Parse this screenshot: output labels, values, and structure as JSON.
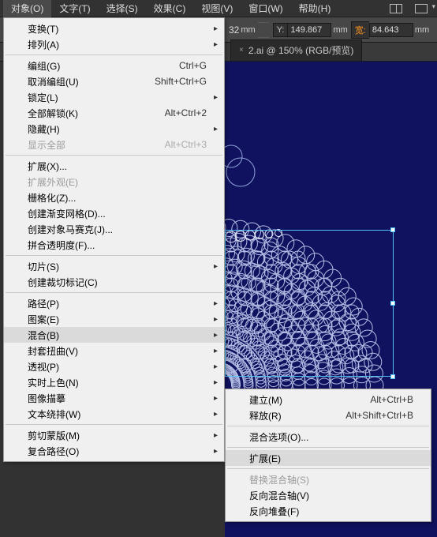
{
  "menubar": {
    "items": [
      "对象(O)",
      "文字(T)",
      "选择(S)",
      "效果(C)",
      "视图(V)",
      "窗口(W)",
      "帮助(H)"
    ]
  },
  "toolbar": {
    "x_suffix": "32",
    "y_label": "Y:",
    "y_value": "149.867",
    "w_label": "宽:",
    "w_value": "84.643",
    "unit": "mm"
  },
  "tabs": {
    "active": "2.ai @ 150% (RGB/预览)"
  },
  "menu": {
    "transform": "变换(T)",
    "arrange": "排列(A)",
    "group": "编组(G)",
    "group_sc": "Ctrl+G",
    "ungroup": "取消编组(U)",
    "ungroup_sc": "Shift+Ctrl+G",
    "lock": "锁定(L)",
    "unlock_all": "全部解锁(K)",
    "unlock_all_sc": "Alt+Ctrl+2",
    "hide": "隐藏(H)",
    "show_all": "显示全部",
    "show_all_sc": "Alt+Ctrl+3",
    "expand": "扩展(X)...",
    "expand_app": "扩展外观(E)",
    "rasterize": "栅格化(Z)...",
    "grad_mesh": "创建渐变网格(D)...",
    "mosaic": "创建对象马赛克(J)...",
    "flatten": "拼合透明度(F)...",
    "slice": "切片(S)",
    "crop": "创建裁切标记(C)",
    "path": "路径(P)",
    "pattern": "图案(E)",
    "blend": "混合(B)",
    "envelope": "封套扭曲(V)",
    "perspective": "透视(P)",
    "live_paint": "实时上色(N)",
    "trace": "图像描摹",
    "wrap": "文本绕排(W)",
    "clip": "剪切蒙版(M)",
    "compound": "复合路径(O)"
  },
  "submenu": {
    "make": "建立(M)",
    "make_sc": "Alt+Ctrl+B",
    "release": "释放(R)",
    "release_sc": "Alt+Shift+Ctrl+B",
    "options": "混合选项(O)...",
    "expand": "扩展(E)",
    "replace": "替换混合轴(S)",
    "reverse_spine": "反向混合轴(V)",
    "reverse_stack": "反向堆叠(F)"
  }
}
